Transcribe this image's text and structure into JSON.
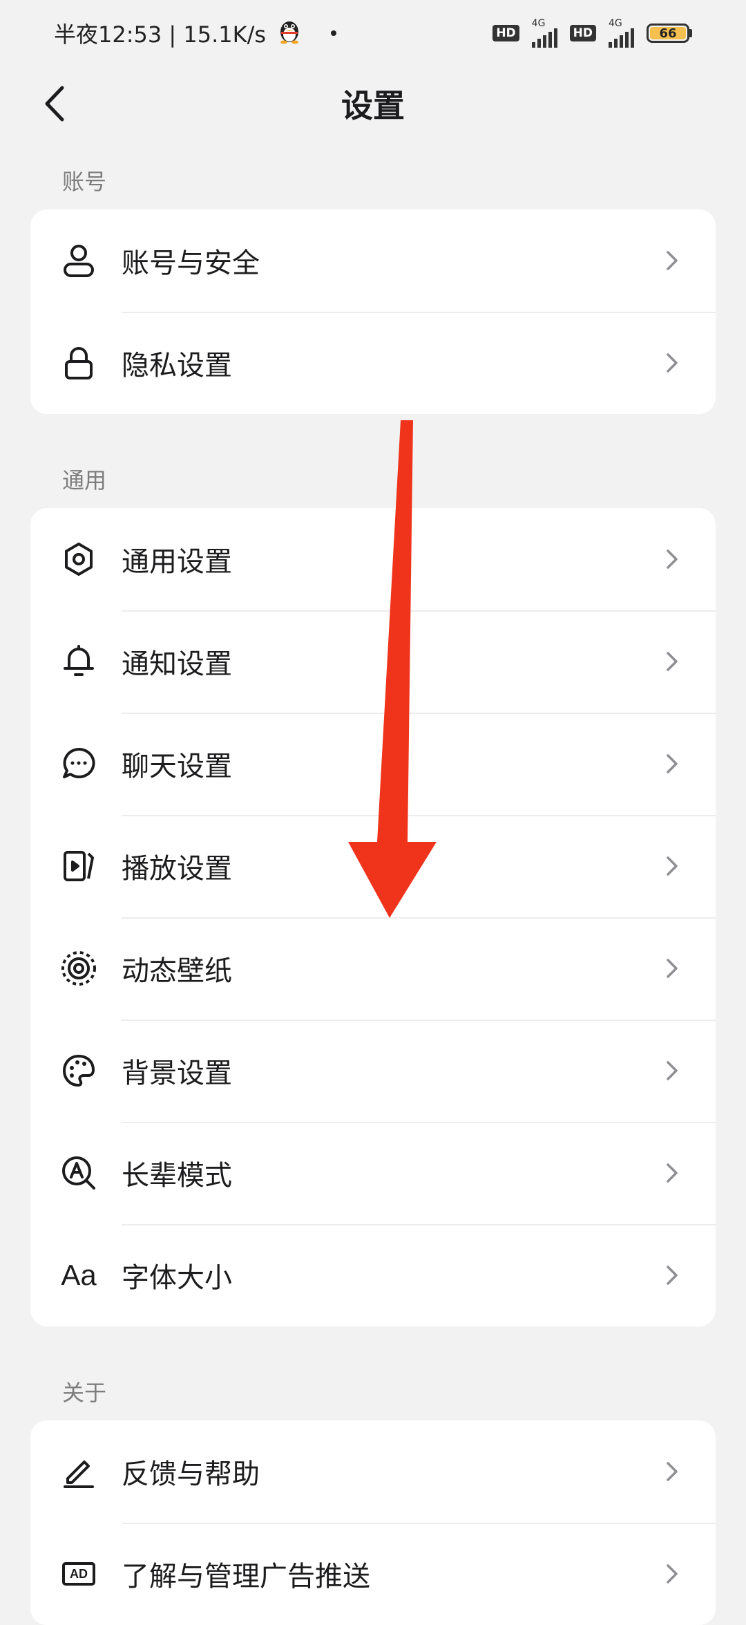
{
  "status_bar": {
    "time_speed": "半夜12:53 | 15.1K/s",
    "hd_label": "HD",
    "net_label": "4G",
    "battery": "66"
  },
  "header": {
    "title": "设置"
  },
  "sections": {
    "account": {
      "label": "账号",
      "items": [
        {
          "label": "账号与安全",
          "icon": "person-icon"
        },
        {
          "label": "隐私设置",
          "icon": "lock-icon"
        }
      ]
    },
    "general": {
      "label": "通用",
      "items": [
        {
          "label": "通用设置",
          "icon": "gear-icon"
        },
        {
          "label": "通知设置",
          "icon": "bell-icon"
        },
        {
          "label": "聊天设置",
          "icon": "chat-bubble-icon"
        },
        {
          "label": "播放设置",
          "icon": "play-video-icon"
        },
        {
          "label": "动态壁纸",
          "icon": "live-wallpaper-icon"
        },
        {
          "label": "背景设置",
          "icon": "palette-icon"
        },
        {
          "label": "长辈模式",
          "icon": "elder-mode-icon"
        },
        {
          "label": "字体大小",
          "icon": "font-size-icon",
          "icon_text": "Aa"
        }
      ]
    },
    "about": {
      "label": "关于",
      "items": [
        {
          "label": "反馈与帮助",
          "icon": "pencil-icon"
        },
        {
          "label": "了解与管理广告推送",
          "icon": "ad-icon",
          "icon_text": "AD"
        }
      ]
    }
  },
  "colors": {
    "background": "#f2f2f2",
    "card": "#ffffff",
    "arrow": "#f0341c",
    "section_text": "#7d7d7d"
  }
}
